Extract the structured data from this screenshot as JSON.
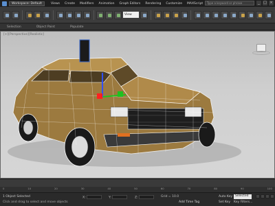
{
  "titlebar": {
    "workspace_label": "Workspace: Default",
    "menu": [
      "Views",
      "Create",
      "Modifiers",
      "Animation",
      "Graph Editors",
      "Rendering",
      "Customize",
      "MAXScript",
      "Help"
    ],
    "window_title": "Autodesk 3ds Max 2014 x64",
    "search_placeholder": "Type a keyword or phrase",
    "buttons": [
      "_",
      "□",
      "×"
    ]
  },
  "toolbar": {
    "view_dropdown": "View"
  },
  "ribbon": {
    "tabs": [
      "Selection",
      "Object Paint",
      "Populate"
    ]
  },
  "viewport": {
    "label": "[+][Perspective][Realistic]"
  },
  "timeline": {
    "ticks": [
      "0",
      "10",
      "20",
      "30",
      "40",
      "50",
      "60",
      "70",
      "80",
      "90",
      "100"
    ]
  },
  "status": {
    "selection": "1 Object Selected",
    "hint": "Click and drag to select and move objects",
    "x_label": "X:",
    "y_label": "Y:",
    "z_label": "Z:",
    "grid": "Grid = 10.0",
    "add_time_tag": "Add Time Tag",
    "auto_key": "Auto Key",
    "set_key": "Set Key",
    "selected_dd": "Selected",
    "key_filters": "Key Filters..."
  },
  "colors": {
    "accent": "#5a8fd0",
    "car_body": "#b08a4a",
    "wire": "#ffffff"
  }
}
